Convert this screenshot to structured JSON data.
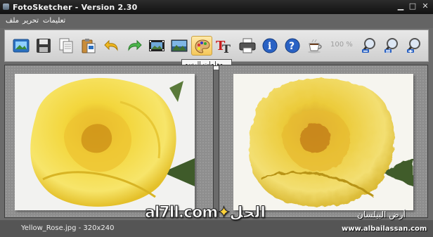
{
  "window": {
    "title": "FotoSketcher - Version 2.30"
  },
  "menu": {
    "items": [
      "ملف",
      "تحرير",
      "تعليمات"
    ]
  },
  "toolbar": {
    "buttons": [
      {
        "name": "open-image-button",
        "icon": "picture-frame-icon"
      },
      {
        "name": "save-button",
        "icon": "floppy-disk-icon"
      },
      {
        "name": "copy-button",
        "icon": "copy-icon"
      },
      {
        "name": "paste-button",
        "icon": "clipboard-icon"
      },
      {
        "name": "undo-button",
        "icon": "undo-arrow-icon"
      },
      {
        "name": "redo-button",
        "icon": "redo-arrow-icon"
      },
      {
        "name": "batch-process-button",
        "icon": "film-strip-icon"
      },
      {
        "name": "landscape-image-button",
        "icon": "landscape-icon"
      },
      {
        "name": "drawing-parameters-button",
        "icon": "paint-palette-icon"
      },
      {
        "name": "add-text-button",
        "icon": "text-tt-icon"
      },
      {
        "name": "print-button",
        "icon": "printer-icon"
      },
      {
        "name": "info-button",
        "icon": "info-icon"
      },
      {
        "name": "help-button",
        "icon": "question-icon"
      },
      {
        "name": "coffee-button",
        "icon": "coffee-cup-icon"
      },
      {
        "name": "zoom-out-button",
        "icon": "zoom-out-icon"
      },
      {
        "name": "zoom-fit-button",
        "icon": "zoom-fit-icon"
      },
      {
        "name": "zoom-in-button",
        "icon": "zoom-in-icon"
      }
    ],
    "zoom_text": "100 %",
    "tooltip": "معلمات الرسم..."
  },
  "status": {
    "text": "Yellow_Rose.jpg - 320x240"
  },
  "watermark": {
    "site1": "al7ll.com",
    "site1_ar": "الحل",
    "site2_ar": "أرض البيلسان",
    "site2": "www.albailassan.com"
  },
  "colors": {
    "rose": "#f2d43a",
    "rose_shadow": "#c99a14",
    "leaf": "#3f5b2a"
  }
}
